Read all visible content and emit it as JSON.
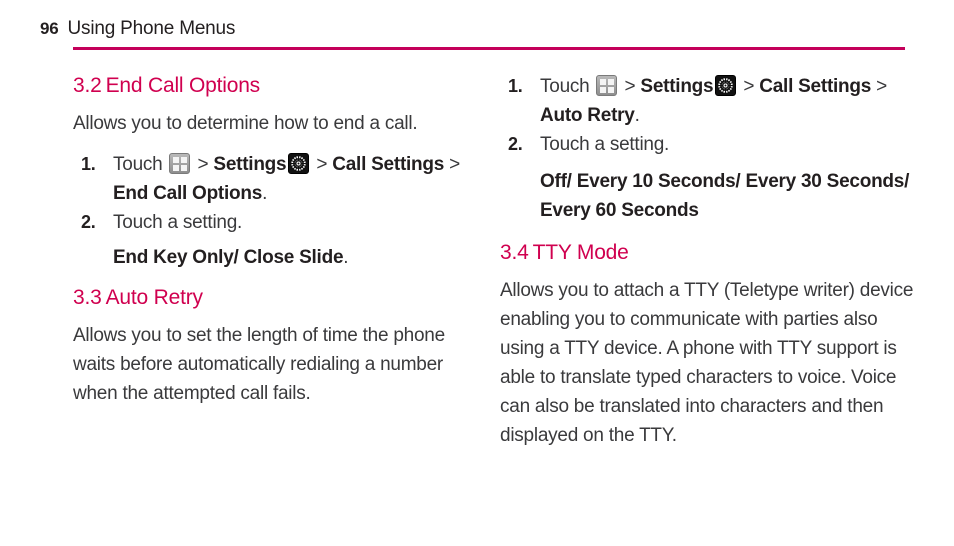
{
  "header": {
    "page_number": "96",
    "title": "Using Phone Menus",
    "rule_color": "#c4005a"
  },
  "theme": {
    "accent": "#d0004f",
    "body_text": "#3a3a3c",
    "strong_text": "#231f20",
    "background": "#ffffff"
  },
  "icons": {
    "grid": "apps-grid-icon",
    "gear": "settings-gear-icon"
  },
  "left_column": {
    "section_end_call": {
      "number": "3.2",
      "title": "End Call Options",
      "intro": "Allows you to determine how to end a call.",
      "steps": [
        {
          "num": "1.",
          "prefix": "Touch ",
          "sep1": " > ",
          "strong1": "Settings",
          "sep2": " > ",
          "strong2": "Call Settings",
          "sep3": " > ",
          "strong3": "End Call Options",
          "period": "."
        },
        {
          "num": "2.",
          "text": "Touch a setting."
        }
      ],
      "options": "End Key Only/ Close Slide",
      "options_period": "."
    },
    "section_auto_retry": {
      "number": "3.3",
      "title": "Auto Retry",
      "intro": "Allows you to set the length of time the phone waits before automatically redialing a number when the attempted call fails."
    }
  },
  "right_column": {
    "auto_retry_steps": [
      {
        "num": "1.",
        "prefix": "Touch ",
        "sep1": " > ",
        "strong1": "Settings",
        "sep2": " > ",
        "strong2": "Call Settings",
        "sep3": " > ",
        "strong3": "Auto Retry",
        "period": "."
      },
      {
        "num": "2.",
        "text": "Touch a setting."
      }
    ],
    "auto_retry_options": "Off/ Every 10 Seconds/ Every 30 Seconds/ Every 60 Seconds",
    "section_tty": {
      "number": "3.4",
      "title": "TTY Mode",
      "body": "Allows you to attach a TTY (Teletype writer) device enabling you to communicate with parties also using a TTY device. A phone with TTY support is able to translate typed characters to voice. Voice can also be translated into characters and then displayed on the TTY."
    }
  }
}
